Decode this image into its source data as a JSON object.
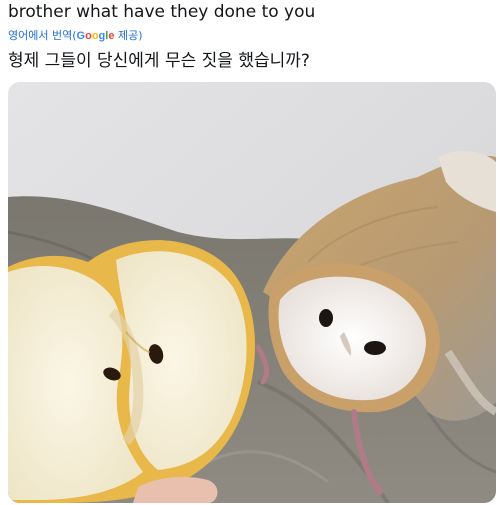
{
  "post": {
    "text": "brother what have they done to you",
    "translate_prefix": "영어에서 번역(",
    "translate_brand": "Google",
    "translate_suffix": " 제공)",
    "translated_text": "형제 그들이 당신에게 무슨 짓을 했습니까?"
  },
  "colors": {
    "link": "#1d6fd8",
    "text": "#14171a"
  }
}
